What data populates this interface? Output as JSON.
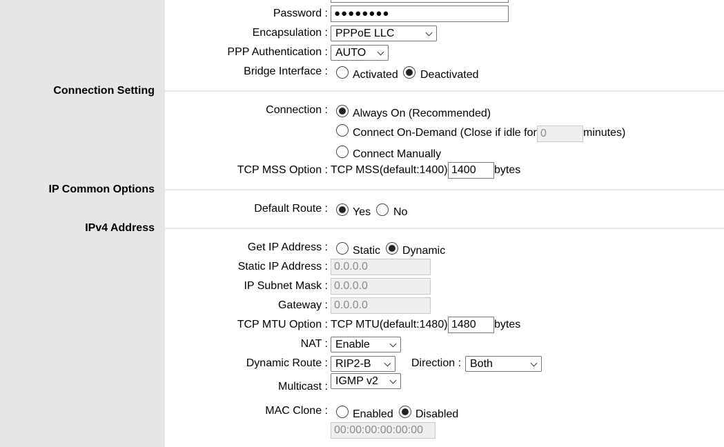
{
  "wan": {
    "password": {
      "label": "Password :",
      "value": "●●●●●●●●"
    },
    "encapsulation": {
      "label": "Encapsulation :",
      "value": "PPPoE LLC"
    },
    "ppp_auth": {
      "label": "PPP Authentication :",
      "value": "AUTO"
    },
    "bridge": {
      "label": "Bridge Interface :",
      "options": [
        "Activated",
        "Deactivated"
      ],
      "selected": "Deactivated"
    }
  },
  "connection_setting": {
    "title": "Connection Setting",
    "connection_label": "Connection :",
    "options": {
      "always_on": "Always On (Recommended)",
      "on_demand_prefix": "Connect On-Demand (Close if idle for",
      "on_demand_placeholder": "0",
      "on_demand_suffix": "minutes)",
      "manual": "Connect Manually"
    },
    "selected": "Always On (Recommended)",
    "tcp_mss": {
      "label": "TCP MSS Option :",
      "text": "TCP MSS(default:1400)",
      "value": "1400",
      "unit": "bytes"
    }
  },
  "ip_common": {
    "title": "IP Common Options",
    "default_route": {
      "label": "Default Route :",
      "options": [
        "Yes",
        "No"
      ],
      "selected": "Yes"
    }
  },
  "ipv4": {
    "title": "IPv4 Address",
    "get_ip": {
      "label": "Get IP Address :",
      "options": [
        "Static",
        "Dynamic"
      ],
      "selected": "Dynamic"
    },
    "static_ip": {
      "label": "Static IP Address :",
      "value": "0.0.0.0"
    },
    "subnet": {
      "label": "IP Subnet Mask :",
      "value": "0.0.0.0"
    },
    "gateway": {
      "label": "Gateway :",
      "value": "0.0.0.0"
    },
    "tcp_mtu": {
      "label": "TCP MTU Option :",
      "text": "TCP MTU(default:1480)",
      "value": "1480",
      "unit": "bytes"
    },
    "nat": {
      "label": "NAT :",
      "value": "Enable"
    },
    "dynamic_route": {
      "label": "Dynamic Route :",
      "value": "RIP2-B",
      "direction_label": "Direction :",
      "direction_value": "Both"
    },
    "multicast": {
      "label": "Multicast :",
      "value": "IGMP v2"
    },
    "mac_clone": {
      "label": "MAC Clone :",
      "options": [
        "Enabled",
        "Disabled"
      ],
      "selected": "Disabled",
      "value": "00:00:00:00:00:00"
    }
  }
}
